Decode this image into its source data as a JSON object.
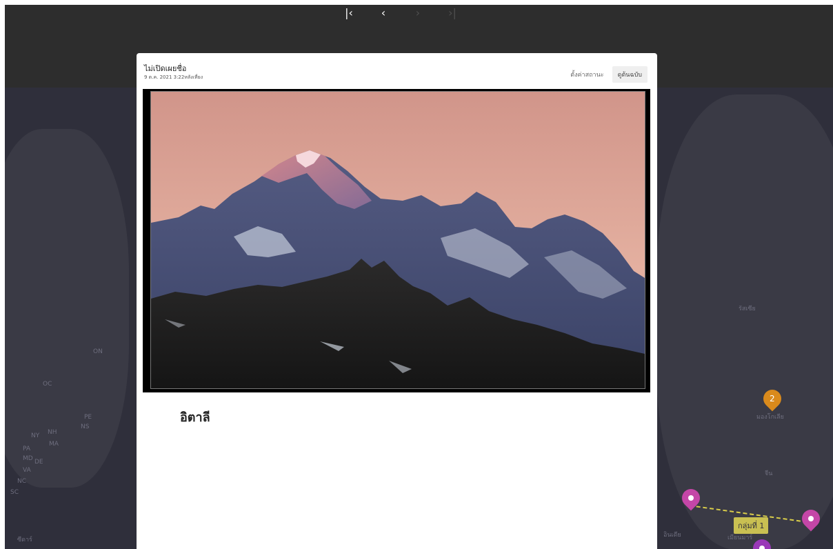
{
  "navigation": {
    "first_label": "|‹",
    "prev_label": "‹",
    "next_label": "›",
    "last_label": "›|"
  },
  "modal": {
    "author": "ไม่เปิดเผยชื่อ",
    "timestamp": "9 ต.ค. 2021 3:22หลังเที่ยง",
    "set_status_label": "ตั้งค่าสถานะ",
    "view_original_label": "ดูต้นฉบับ",
    "caption": "อิตาลี"
  },
  "map": {
    "labels": [
      "ซีดาร์",
      "รัสเซีย",
      "มองโกเลีย",
      "จีน",
      "อินเดีย",
      "เมียนมาร์",
      "OC",
      "ON",
      "NY",
      "NH",
      "MA",
      "PE",
      "NS",
      "PA",
      "MD",
      "DE",
      "VA",
      "NC",
      "SC"
    ],
    "cluster_count": "2",
    "group_label": "กลุ่มที่ 1"
  },
  "colors": {
    "topbar": "#2d2d2d",
    "map_bg": "#2f2f3b",
    "pin_purple": "#c446a7",
    "pin_orange": "#d98a1c",
    "route_yellow": "#d9cd4a"
  }
}
